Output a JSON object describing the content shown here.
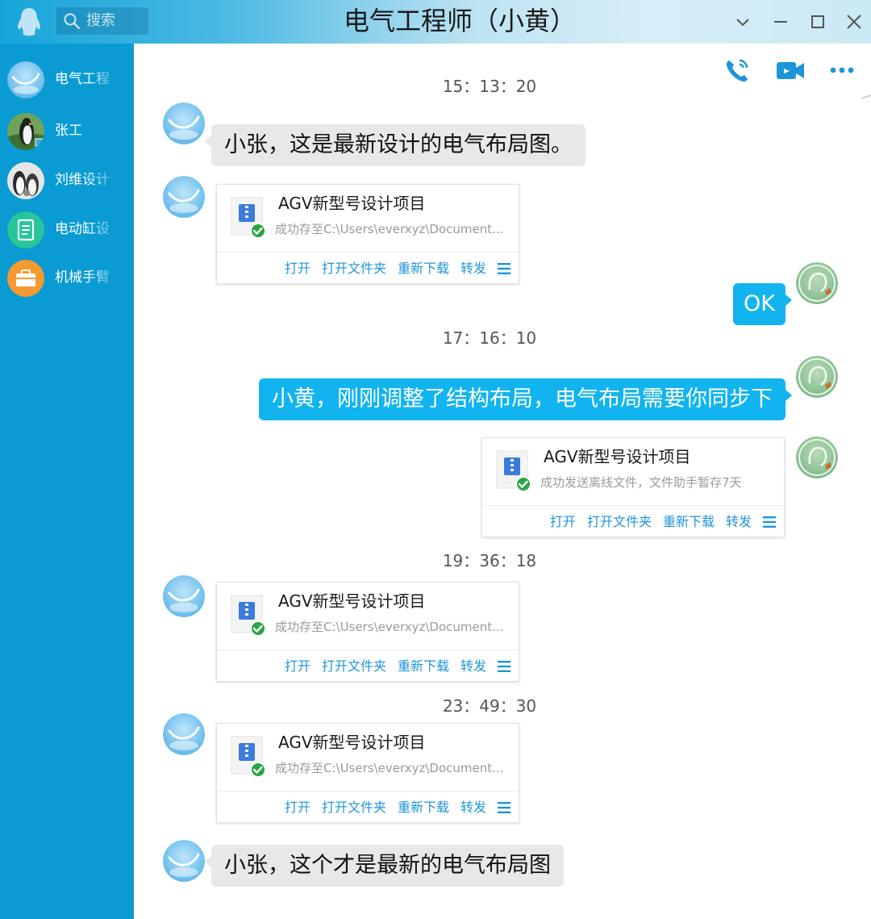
{
  "window": {
    "title": "电气工程师（小黄）",
    "search_placeholder": "搜索"
  },
  "colors": {
    "sidebar": "#0a9bd3",
    "accent": "#12b4ef",
    "link": "#1e95d9",
    "gray_bubble": "#e8e8e8",
    "success": "#26a744"
  },
  "sidebar": {
    "contacts": [
      {
        "name": "电气工程",
        "avatar": "cloud-smile-avatar"
      },
      {
        "name": "张工",
        "avatar": "penguin-avatar"
      },
      {
        "name": "刘维设计",
        "avatar": "penguins-avatar"
      },
      {
        "name": "电动缸设",
        "avatar": "document-avatar"
      },
      {
        "name": "机械手臂",
        "avatar": "briefcase-avatar"
      }
    ]
  },
  "toolbar": {
    "icons": [
      "phone-call-icon",
      "video-call-icon",
      "more-icon"
    ]
  },
  "file_actions": {
    "open": "打开",
    "open_folder": "打开文件夹",
    "redownload": "重新下载",
    "forward": "转发"
  },
  "timestamps": [
    "15：13：20",
    "17：16：10",
    "19：36：18",
    "23：49：30"
  ],
  "messages": {
    "m1": "小张，这是最新设计的电气布局图。",
    "m3": "OK",
    "m4": "小黄，刚刚调整了结构布局，电气布局需要你同步下",
    "m8": "小张，这个才是最新的电气布局图"
  },
  "files": {
    "f1": {
      "name": "AGV新型号设计项目",
      "status": "成功存至C:\\Users\\everxyz\\Document..."
    },
    "f2": {
      "name": "AGV新型号设计项目",
      "status": "成功发送离线文件，文件助手暂存7天"
    },
    "f3": {
      "name": "AGV新型号设计项目",
      "status": "成功存至C:\\Users\\everxyz\\Document..."
    },
    "f4": {
      "name": "AGV新型号设计项目",
      "status": "成功存至C:\\Users\\everxyz\\Document..."
    }
  }
}
